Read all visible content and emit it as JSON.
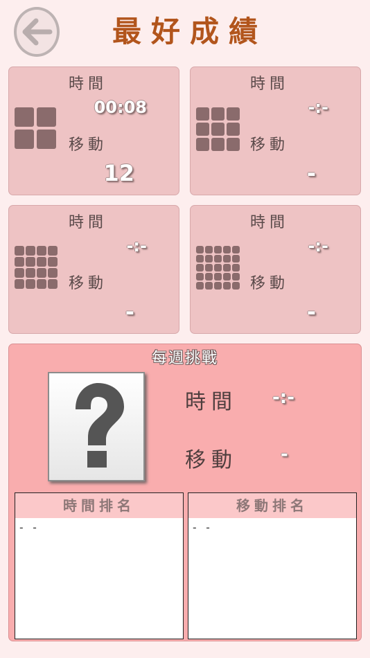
{
  "header": {
    "title": "最好成績",
    "back_icon": "arrow-left-icon"
  },
  "labels": {
    "time": "時間",
    "moves": "移動"
  },
  "records": [
    {
      "size": 2,
      "time": "00:08",
      "moves": "12"
    },
    {
      "size": 3,
      "time": "-:-",
      "moves": "-"
    },
    {
      "size": 4,
      "time": "-:-",
      "moves": "-"
    },
    {
      "size": 5,
      "time": "-:-",
      "moves": "-"
    }
  ],
  "weekly": {
    "title": "每週挑戰",
    "icon": "question-mark-icon",
    "time": "-:-",
    "moves": "-",
    "time_ranking_title": "時間排名",
    "moves_ranking_title": "移動排名",
    "time_ranking": "- -",
    "moves_ranking": "- -"
  },
  "colors": {
    "background": "#fdeeee",
    "card": "#eec3c4",
    "weekly_panel": "#f9adae",
    "title": "#b2551c",
    "tile": "#8a6b6c"
  }
}
